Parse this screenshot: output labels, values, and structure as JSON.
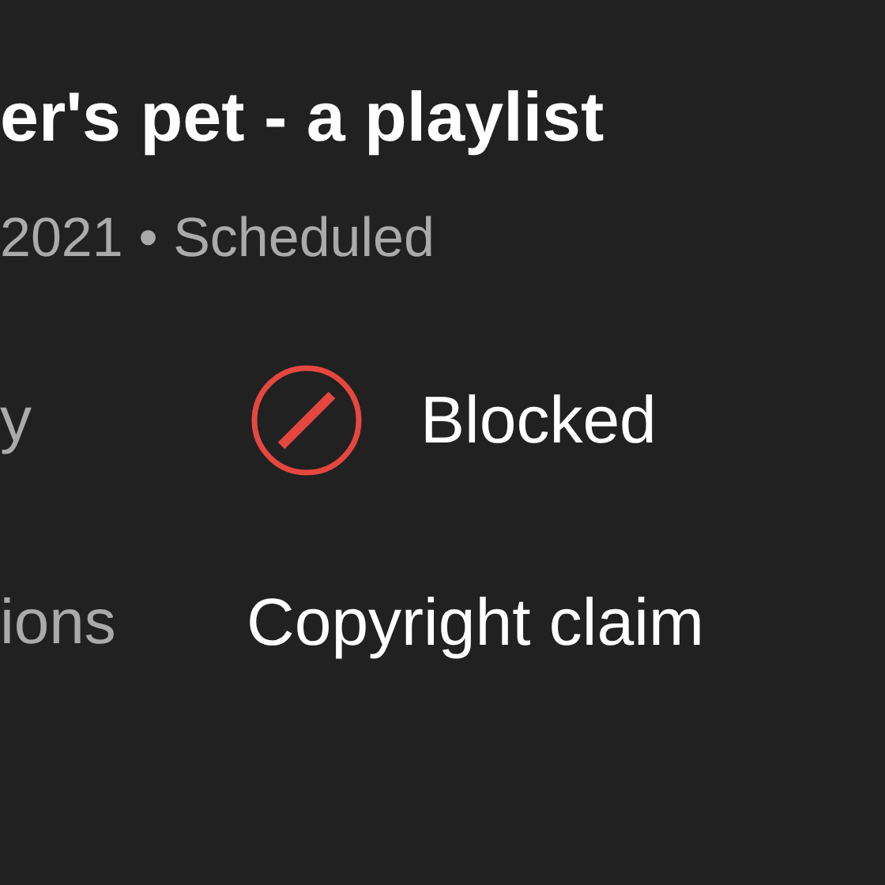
{
  "title": "er's pet - a playlist",
  "subtitle": "2021 • Scheduled",
  "details": [
    {
      "label": "y",
      "value": "Blocked",
      "kind": "blocked"
    },
    {
      "label": "ions",
      "value": "Copyright claim",
      "kind": "text"
    }
  ]
}
